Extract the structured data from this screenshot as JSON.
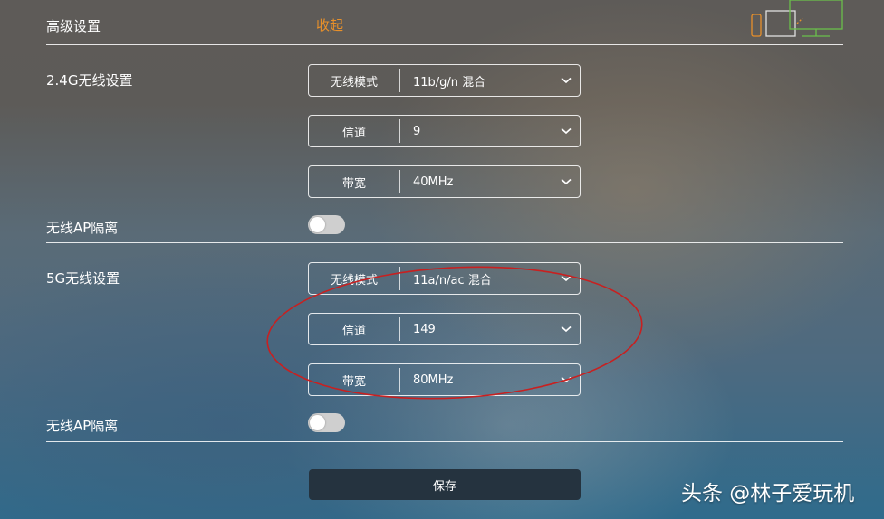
{
  "header": {
    "title": "高级设置",
    "collapse_label": "收起"
  },
  "band_24g": {
    "section_label": "2.4G无线设置",
    "mode": {
      "label": "无线模式",
      "value": "11b/g/n 混合"
    },
    "channel": {
      "label": "信道",
      "value": "9"
    },
    "bandwidth": {
      "label": "带宽",
      "value": "40MHz"
    },
    "ap_isolation": {
      "label": "无线AP隔离",
      "enabled": false
    }
  },
  "band_5g": {
    "section_label": "5G无线设置",
    "mode": {
      "label": "无线模式",
      "value": "11a/n/ac 混合"
    },
    "channel": {
      "label": "信道",
      "value": "149"
    },
    "bandwidth": {
      "label": "带宽",
      "value": "80MHz"
    },
    "ap_isolation": {
      "label": "无线AP隔离",
      "enabled": false
    }
  },
  "actions": {
    "save_label": "保存"
  },
  "watermark": "头条 @林子爱玩机",
  "icons": {
    "dropdown": "chevron-down-icon",
    "devices": "devices-illustration",
    "annotation": "red-circle-annotation"
  },
  "colors": {
    "accent_orange": "#e8902a",
    "save_button_bg": "#25333f",
    "annotation_red": "#c82020",
    "toggle_off": "#cfcfcf",
    "device_green": "#6abf4b",
    "device_orange": "#e8902a"
  }
}
